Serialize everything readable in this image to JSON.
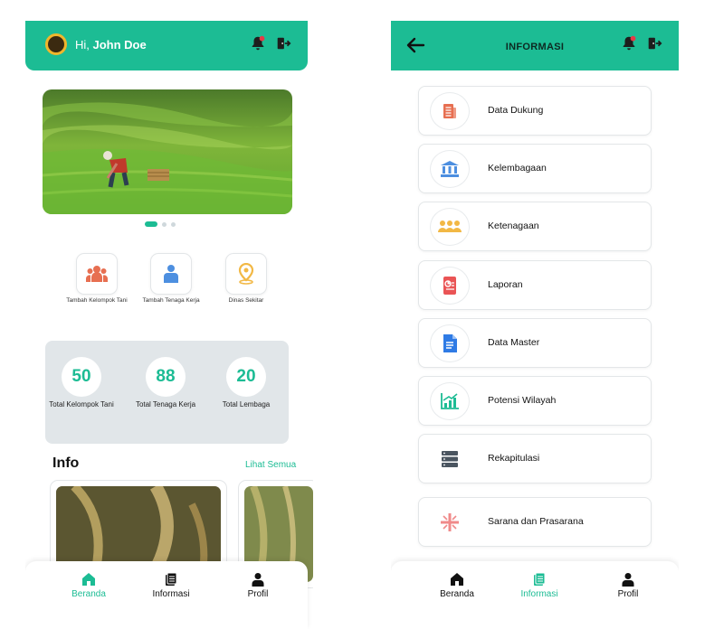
{
  "home": {
    "greeting_prefix": "Hi, ",
    "user_name": "John Doe",
    "quick_actions": [
      {
        "label": "Tambah Kelompok Tani"
      },
      {
        "label": "Tambah Tenaga Kerja"
      },
      {
        "label": "Dinas Sekitar"
      }
    ],
    "stats": [
      {
        "value": "50",
        "label": "Total Kelompok Tani"
      },
      {
        "value": "88",
        "label": "Total Tenaga Kerja"
      },
      {
        "value": "20",
        "label": "Total Lembaga"
      }
    ],
    "info_title": "Info",
    "info_link": "Lihat Semua",
    "carousel_active_index": 0,
    "carousel_count": 3
  },
  "informasi": {
    "title": "INFORMASI",
    "menu": [
      {
        "label": "Data Dukung",
        "icon": "document-icon",
        "color": "#e76f51"
      },
      {
        "label": "Kelembagaan",
        "icon": "institution-icon",
        "color": "#4d8fe0"
      },
      {
        "label": "Ketenagaan",
        "icon": "people-icon",
        "color": "#f2b845"
      },
      {
        "label": "Laporan",
        "icon": "report-icon",
        "color": "#ea5455"
      },
      {
        "label": "Data Master",
        "icon": "file-icon",
        "color": "#2f7be5"
      },
      {
        "label": "Potensi Wilayah",
        "icon": "growth-chart-icon",
        "color": "#1cbc94"
      },
      {
        "label": "Rekapitulasi",
        "icon": "server-icon",
        "color": "#4a5560"
      },
      {
        "label": "Sarana dan Prasarana",
        "icon": "facility-icon",
        "color": "#f08a8a"
      }
    ]
  },
  "nav": {
    "items": [
      {
        "label": "Beranda"
      },
      {
        "label": "Informasi"
      },
      {
        "label": "Profil"
      }
    ],
    "left_active": "Beranda",
    "right_active": "Informasi"
  },
  "colors": {
    "primary": "#1cbc94",
    "stats_bg": "#e1e6e9",
    "notification": "#e63946"
  }
}
